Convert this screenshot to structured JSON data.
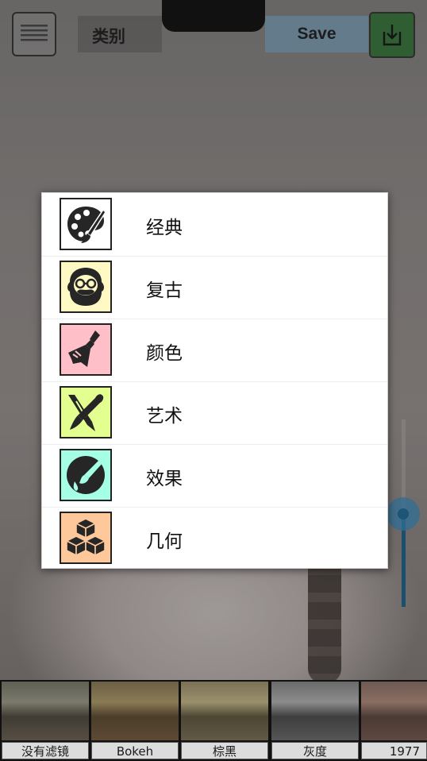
{
  "header": {
    "title": "类别",
    "save_label": "Save"
  },
  "categories": [
    {
      "label": "经典",
      "icon": "palette-icon",
      "color": "#ffffff"
    },
    {
      "label": "复古",
      "icon": "bearded-man-icon",
      "color": "#fff9c4"
    },
    {
      "label": "颜色",
      "icon": "paint-brush-icon",
      "color": "#ffbfc8"
    },
    {
      "label": "艺术",
      "icon": "brush-pen-icon",
      "color": "#e3ff8f"
    },
    {
      "label": "效果",
      "icon": "effect-brush-icon",
      "color": "#a5ffe4"
    },
    {
      "label": "几何",
      "icon": "cubes-icon",
      "color": "#ffc89a"
    }
  ],
  "filters": [
    {
      "label": "没有滤镜"
    },
    {
      "label": "Bokeh"
    },
    {
      "label": "棕黑"
    },
    {
      "label": "灰度"
    },
    {
      "label": "1977"
    }
  ],
  "slider": {
    "value": 0.5
  }
}
